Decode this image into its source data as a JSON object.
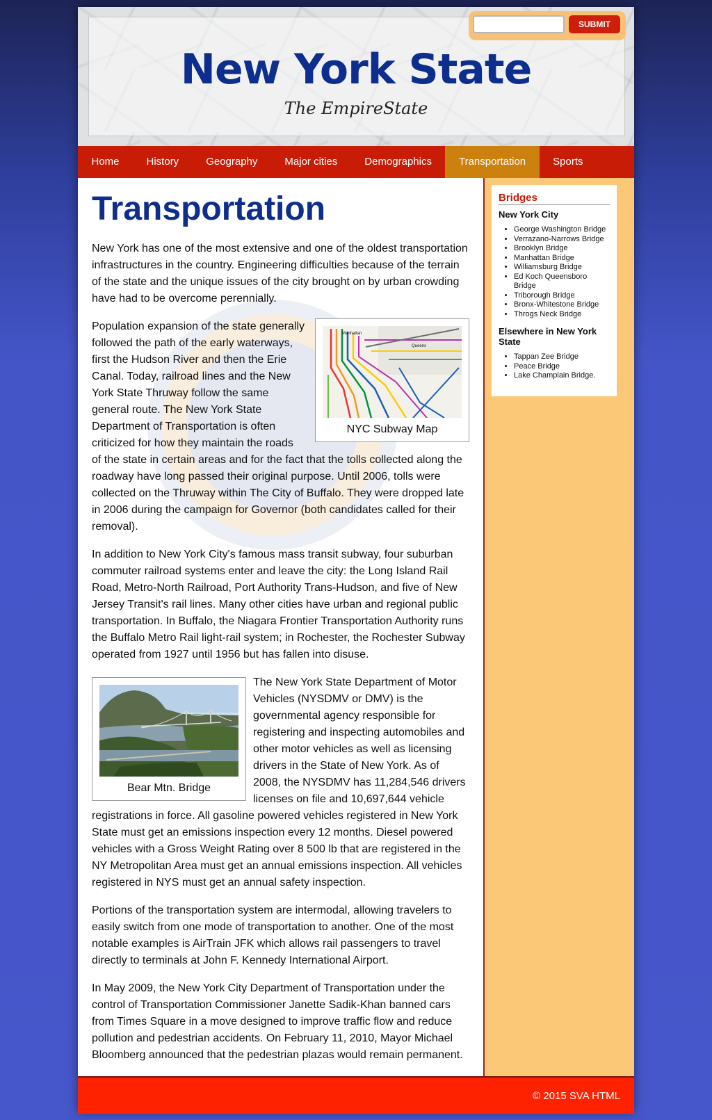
{
  "header": {
    "title": "New York State",
    "tagline": "The EmpireState",
    "search": {
      "value": "",
      "placeholder": "",
      "submit_label": "SUBMIT"
    }
  },
  "nav": {
    "items": [
      {
        "label": "Home"
      },
      {
        "label": "History"
      },
      {
        "label": "Geography"
      },
      {
        "label": "Major cities"
      },
      {
        "label": "Demographics"
      },
      {
        "label": "Transportation",
        "active": true
      },
      {
        "label": "Sports"
      }
    ]
  },
  "main": {
    "heading": "Transportation",
    "paragraphs": [
      "New York has one of the most extensive and one of the oldest transportation infrastructures in the country. Engineering difficulties because of the terrain of the state and the unique issues of the city brought on by urban crowding have had to be overcome perennially.",
      "Population expansion of the state generally followed the path of the early waterways, first the Hudson River and then the Erie Canal. Today, railroad lines and the New York State Thruway follow the same general route. The New York State Department of Transportation is often criticized for how they maintain the roads of the state in certain areas and for the fact that the tolls collected along the roadway have long passed their original purpose. Until 2006, tolls were collected on the Thruway within The City of Buffalo. They were dropped late in 2006 during the campaign for Governor (both candidates called for their removal).",
      "In addition to New York City's famous mass transit subway, four suburban commuter railroad systems enter and leave the city: the Long Island Rail Road, Metro-North Railroad, Port Authority Trans-Hudson, and five of New Jersey Transit's rail lines. Many other cities have urban and regional public transportation. In Buffalo, the Niagara Frontier Transportation Authority runs the Buffalo Metro Rail light-rail system; in Rochester, the Rochester Subway operated from 1927 until 1956 but has fallen into disuse.",
      "The New York State Department of Motor Vehicles (NYSDMV or DMV) is the governmental agency responsible for registering and inspecting automobiles and other motor vehicles as well as licensing drivers in the State of New York. As of 2008, the NYSDMV has 11,284,546 drivers licenses on file and 10,697,644 vehicle registrations in force. All gasoline powered vehicles registered in New York State must get an emissions inspection every 12 months. Diesel powered vehicles with a Gross Weight Rating over 8 500 lb that are registered in the NY Metropolitan Area must get an annual emissions inspection. All vehicles registered in NYS must get an annual safety inspection.",
      "Portions of the transportation system are intermodal, allowing travelers to easily switch from one mode of transportation to another. One of the most notable examples is AirTrain JFK which allows rail passengers to travel directly to terminals at John F. Kennedy International Airport.",
      "In May 2009, the New York City Department of Transportation under the control of Transportation Commissioner Janette Sadik-Khan banned cars from Times Square in a move designed to improve traffic flow and reduce pollution and pedestrian accidents. On February 11, 2010, Mayor Michael Bloomberg announced that the pedestrian plazas would remain permanent."
    ],
    "figures": {
      "subway": {
        "caption": "NYC Subway Map",
        "labels": [
          "Manhattan",
          "Queens"
        ]
      },
      "bridge": {
        "caption": "Bear Mtn. Bridge"
      }
    }
  },
  "sidebar": {
    "title": "Bridges",
    "groups": [
      {
        "heading": "New York City",
        "items": [
          "George Washington Bridge",
          "Verrazano-Narrows Bridge",
          "Brooklyn Bridge",
          "Manhattan Bridge",
          "Williamsburg Bridge",
          "Ed Koch Queensboro Bridge",
          "Triborough Bridge",
          "Bronx-Whitestone Bridge",
          "Throgs Neck Bridge"
        ]
      },
      {
        "heading": "Elsewhere in New York State",
        "items": [
          "Tappan Zee Bridge",
          "Peace Bridge",
          "Lake Champlain Bridge."
        ]
      }
    ]
  },
  "footer": {
    "text": "© 2015 SVA HTML"
  },
  "colors": {
    "nav_bg": "#c81c06",
    "nav_active": "#cc800d",
    "heading": "#0d2e8c",
    "sidebar_bg": "#fbc877",
    "footer_bg": "#ff2200"
  }
}
